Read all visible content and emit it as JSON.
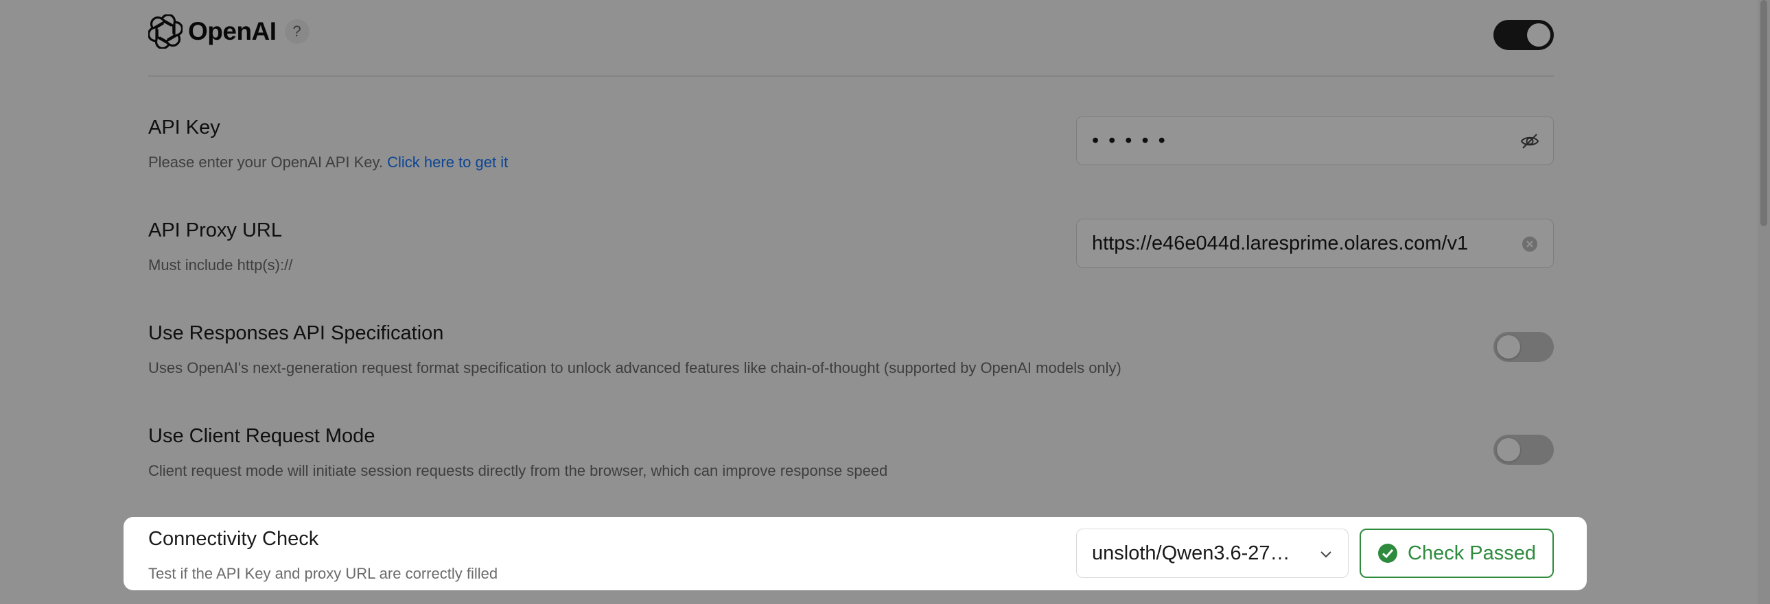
{
  "header": {
    "brand_name": "OpenAI",
    "help_label": "?",
    "enabled": true
  },
  "api_key": {
    "title": "API Key",
    "description": "Please enter your OpenAI API Key.",
    "link_text": "Click here to get it",
    "masked_value": "•••••",
    "toggle_icon": "eye-off-icon"
  },
  "proxy_url": {
    "title": "API Proxy URL",
    "description": "Must include http(s)://",
    "value": "https://e46e044d.laresprime.olares.com/v1",
    "clear_icon": "clear-icon"
  },
  "responses_api": {
    "title": "Use Responses API Specification",
    "description": "Uses OpenAI's next-generation request format specification to unlock advanced features like chain-of-thought (supported by OpenAI models only)",
    "enabled": false
  },
  "client_mode": {
    "title": "Use Client Request Mode",
    "description": "Client request mode will initiate session requests directly from the browser, which can improve response speed",
    "enabled": false
  },
  "connectivity": {
    "title": "Connectivity Check",
    "description": "Test if the API Key and proxy URL are correctly filled",
    "model_selected": "unsloth/Qwen3.6-27…",
    "button_label": "Check Passed",
    "status_color": "#2e8b3e"
  },
  "colors": {
    "link": "#1677ff",
    "toggle_on": "#1f1f1f",
    "toggle_off": "#c4c4c4",
    "success": "#2e8b3e"
  }
}
